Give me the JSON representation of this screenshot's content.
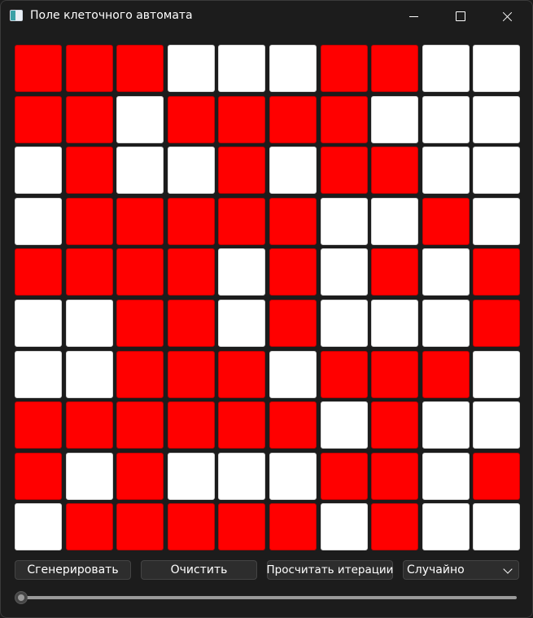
{
  "window": {
    "title": "Поле клеточного автомата"
  },
  "colors": {
    "alive": "#ff0000",
    "dead": "#ffffff",
    "background": "#1c1c1c"
  },
  "icons": {
    "app": "window-app-icon",
    "minimize": "minimize-icon",
    "maximize": "maximize-icon",
    "close": "close-icon",
    "dropdown": "chevron-down-icon"
  },
  "grid": {
    "rows": 10,
    "cols": 10,
    "cells": [
      [
        1,
        1,
        1,
        0,
        0,
        0,
        1,
        1,
        0,
        0
      ],
      [
        1,
        1,
        0,
        1,
        1,
        1,
        1,
        0,
        0,
        0
      ],
      [
        0,
        1,
        0,
        0,
        1,
        0,
        1,
        1,
        0,
        0
      ],
      [
        0,
        1,
        1,
        1,
        1,
        1,
        0,
        0,
        1,
        0
      ],
      [
        1,
        1,
        1,
        1,
        0,
        1,
        0,
        1,
        0,
        1
      ],
      [
        0,
        0,
        1,
        1,
        0,
        1,
        0,
        0,
        0,
        1
      ],
      [
        0,
        0,
        1,
        1,
        1,
        0,
        1,
        1,
        1,
        0
      ],
      [
        1,
        1,
        1,
        1,
        1,
        1,
        0,
        1,
        0,
        0
      ],
      [
        1,
        0,
        1,
        0,
        0,
        0,
        1,
        1,
        0,
        1
      ],
      [
        0,
        1,
        1,
        1,
        1,
        1,
        0,
        1,
        0,
        0
      ]
    ]
  },
  "controls": {
    "generate_label": "Сгенерировать",
    "clear_label": "Очистить",
    "iterate_label": "Просчитать итерации",
    "mode_selected": "Случайно"
  },
  "slider": {
    "value": 0,
    "min": 0,
    "max": 100
  }
}
